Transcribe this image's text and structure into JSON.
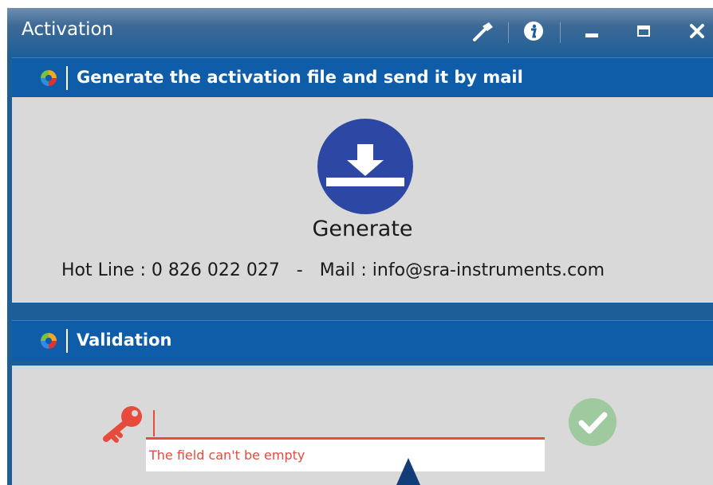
{
  "window": {
    "title": "Activation"
  },
  "titlebar_icons": {
    "tools": "hammer-icon",
    "info": "info-icon",
    "minimize": "minimize-icon",
    "maximize": "maximize-icon",
    "close": "close-icon"
  },
  "generate_panel": {
    "header": "Generate the activation file and send it by mail",
    "button_label": "Generate",
    "contact_line": "Hot Line : 0 826 022 027   -   Mail : info@sra-instruments.com"
  },
  "validation_panel": {
    "header": "Validation",
    "input_value": "",
    "error_message": "The field can't be empty"
  },
  "colors": {
    "header_blue": "#0f5da8",
    "generate_circle": "#2d48a4",
    "error_red": "#e64b3c",
    "check_green": "#9fc99f",
    "panel_gray": "#d9d9d9"
  }
}
